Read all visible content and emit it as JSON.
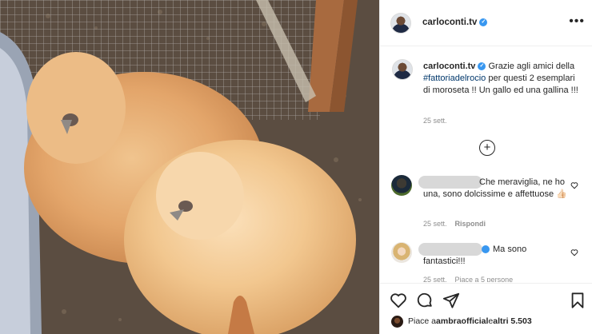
{
  "post": {
    "username": "carloconti.tv",
    "verified_mark": "✓",
    "more_icon": "more-horizontal-icon",
    "caption": {
      "before_tag": "Grazie agli amici della ",
      "hashtag": "#fattoriadelrocio",
      "after_tag": " per questi 2 esemplari di moroseta !! Un gallo ed una gallina !!!",
      "time": "25 sett."
    },
    "load_more_icon": "plus-circle-icon"
  },
  "comments": [
    {
      "text": "Che meraviglia, ne ho una, sono dolcissime e affettuose 👍🏻",
      "time": "25 sett.",
      "reply_label": "Rispondi"
    },
    {
      "text": "Ma sono fantastici!!!",
      "time": "25 sett.",
      "likes_text": "Piace a 5 persone"
    }
  ],
  "actions": {
    "icons": [
      "heart-icon",
      "comment-icon",
      "share-icon",
      "bookmark-icon"
    ],
    "likes_prefix": "Piace a ",
    "likes_user": "ambraofficial",
    "likes_mid": " e ",
    "likes_others": "altri 5.503"
  }
}
